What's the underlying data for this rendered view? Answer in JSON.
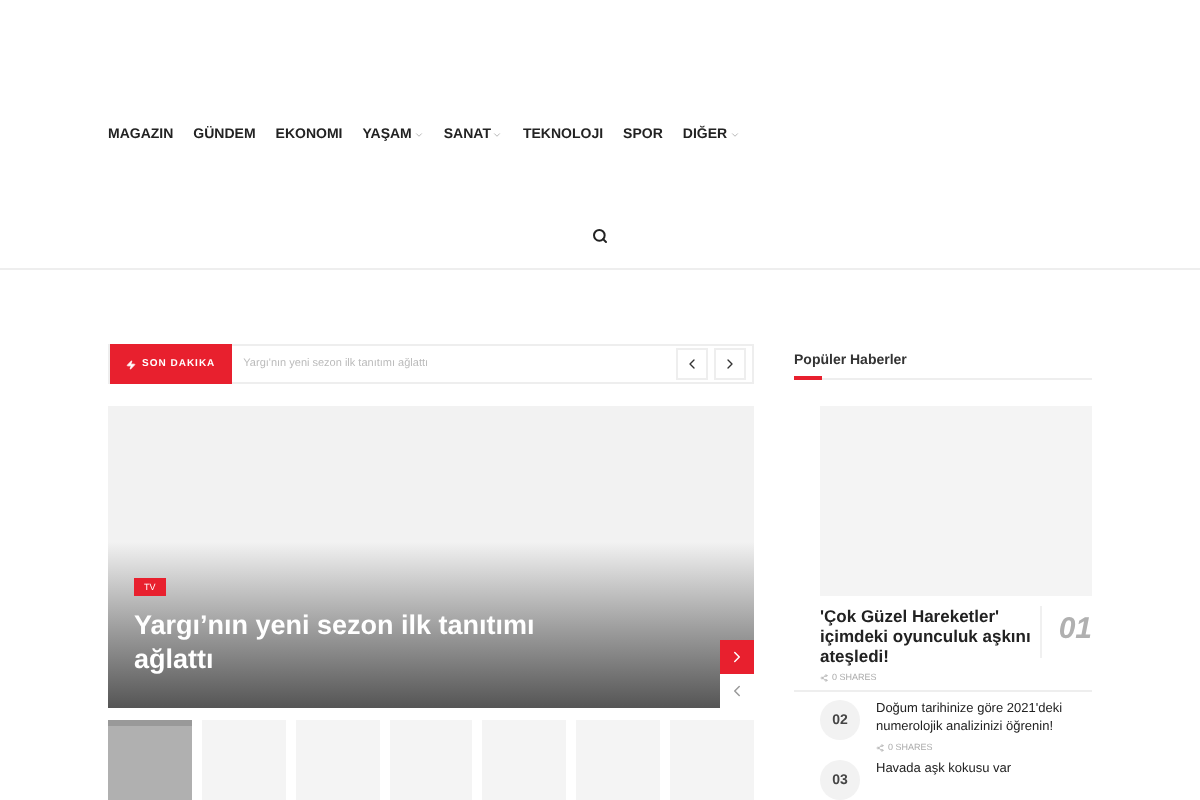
{
  "nav": [
    {
      "label": "MAGAZIN",
      "dropdown": false
    },
    {
      "label": "GÜNDEM",
      "dropdown": false
    },
    {
      "label": "EKONOMI",
      "dropdown": false
    },
    {
      "label": "YAŞAM",
      "dropdown": true
    },
    {
      "label": "SANAT",
      "dropdown": true
    },
    {
      "label": "TEKNOLOJI",
      "dropdown": false
    },
    {
      "label": "SPOR",
      "dropdown": false
    },
    {
      "label": "DIĞER",
      "dropdown": true
    }
  ],
  "ticker": {
    "label": "SON DAKIKA",
    "headline": "Yargı'nın yeni sezon ilk tanıtımı ağlattı"
  },
  "hero": {
    "category": "TV",
    "title": "Yargı’nın yeni sezon ilk tanıtımı ağlattı"
  },
  "thumbnails": [
    {
      "selected": true
    },
    {
      "selected": false
    },
    {
      "selected": false
    },
    {
      "selected": false
    },
    {
      "selected": false
    },
    {
      "selected": false
    },
    {
      "selected": false
    }
  ],
  "sidebar": {
    "title": "Popüler Haberler",
    "featured": {
      "title": "'Çok Güzel Hareketler' içimdeki oyunculuk aşkını ateşledi!",
      "rank": "01",
      "shares": "0 SHARES"
    },
    "items": [
      {
        "rank": "02",
        "title": "Doğum tarihinize göre 2021'deki numerolojik analizinizi öğrenin!",
        "shares": "0 SHARES"
      },
      {
        "rank": "03",
        "title": "Havada aşk kokusu var"
      }
    ]
  }
}
